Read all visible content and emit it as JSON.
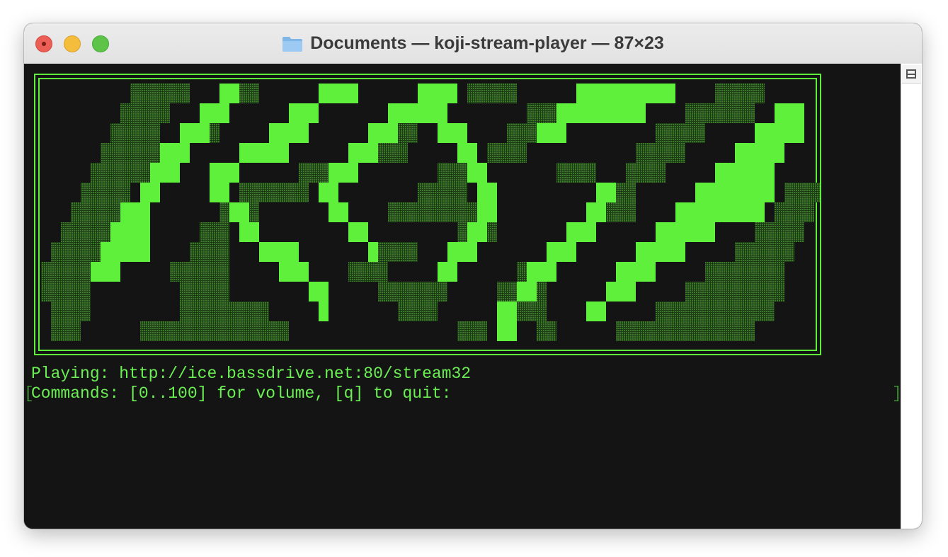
{
  "window": {
    "title": "Documents — koji-stream-player — 87×23",
    "folder_icon": "folder-icon"
  },
  "colors": {
    "foreground": "#6bf053",
    "bright": "#5ef03a",
    "dim_pattern": "#3c7a2a",
    "background": "#141414"
  },
  "terminal": {
    "banner_text": "KOJI",
    "playing_line": "Playing: http://ice.bassdrive.net:80/stream32",
    "commands_line": "Commands: [0..100] for volume, [q] to quit:",
    "bracket_left": "[",
    "bracket_right": "]"
  }
}
